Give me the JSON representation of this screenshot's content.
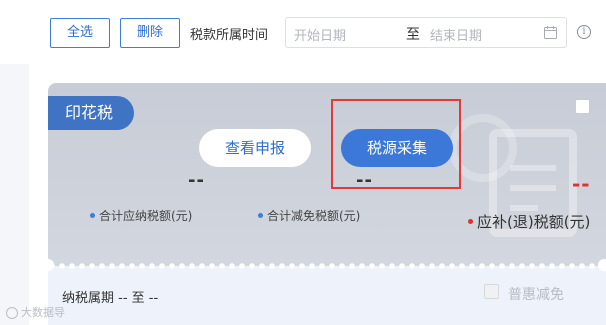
{
  "toolbar": {
    "select_all": "全选",
    "delete": "删除",
    "period_label": "税款所属时间",
    "start_placeholder": "开始日期",
    "separator": "至",
    "end_placeholder": "结束日期"
  },
  "card": {
    "tax_type": "印花税",
    "view_button": "查看申报",
    "collect_button": "税源采集",
    "payable_value": "--",
    "reduction_value": "--",
    "refund_value": "--",
    "payable_label": "合计应纳税额(元)",
    "reduction_label": "合计减免税额(元)",
    "refund_label": "应补(退)税额(元)",
    "tax_period": "纳税属期 -- 至 --",
    "inclusive_relief": "普惠减免"
  },
  "watermark": "大数据导",
  "colors": {
    "accent": "#3b78d8",
    "highlight": "#e03a3a",
    "negative": "#e0312e"
  }
}
